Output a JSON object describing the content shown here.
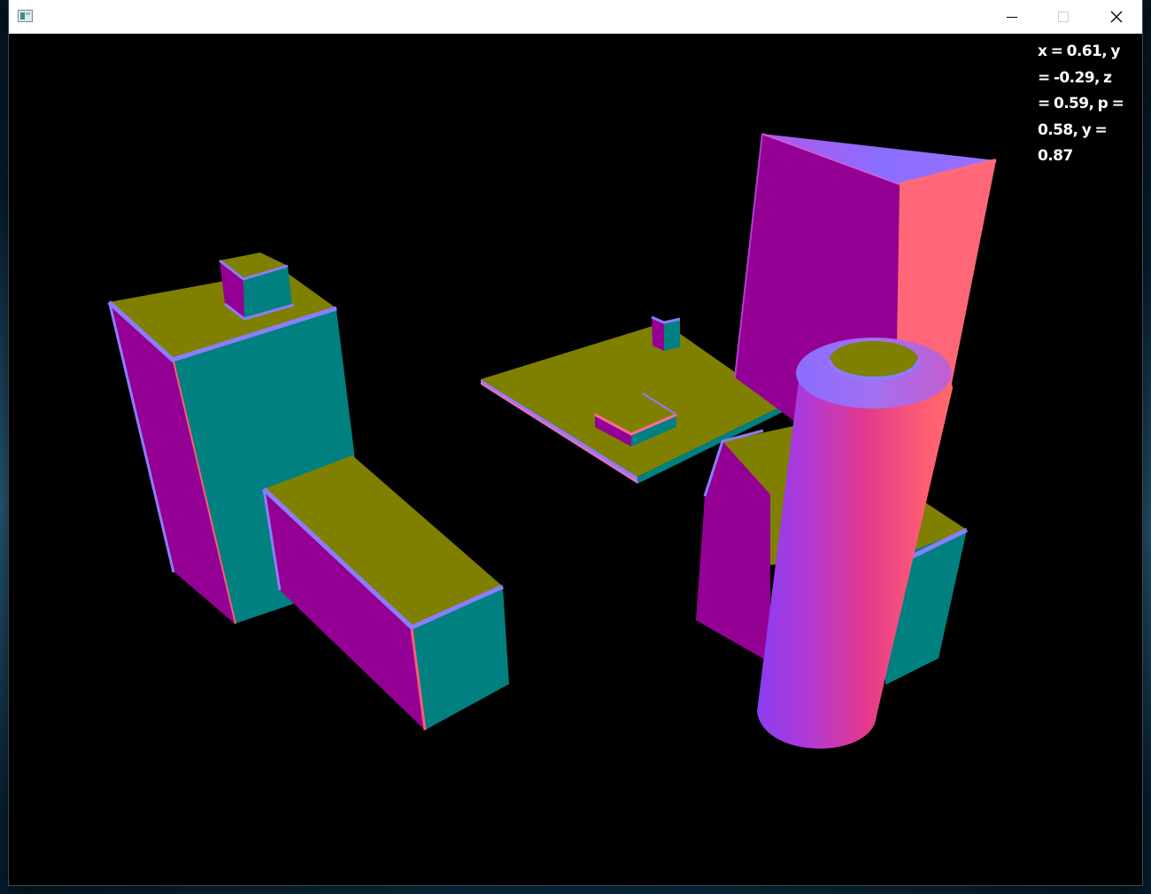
{
  "window": {
    "title": "",
    "icon": "app-window-icon",
    "controls": {
      "minimize_icon": "minimize-icon",
      "maximize_icon": "maximize-icon",
      "close_icon": "close-icon"
    }
  },
  "viewport": {
    "background": "#000000",
    "camera_readout": "x = 0.61, y = -0.29, z = 0.59, p = 0.58, y = 0.87"
  },
  "colors": {
    "teal_face": "#008080",
    "olive_face": "#808000",
    "magenta_face": "#930093",
    "pink_face": "#ff6677",
    "blue_edge": "#8a7dff"
  }
}
